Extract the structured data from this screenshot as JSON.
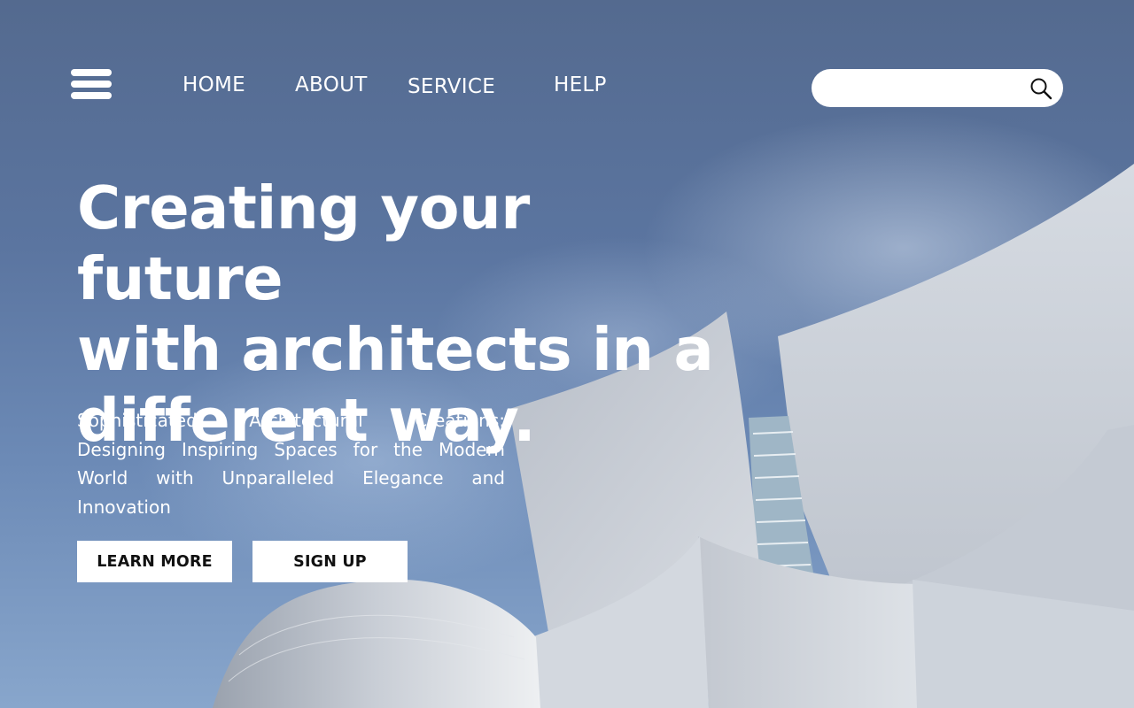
{
  "nav": {
    "menu_icon": "hamburger-menu-icon",
    "links": [
      {
        "label": "HOME"
      },
      {
        "label": "ABOUT"
      },
      {
        "label": "SERVICE"
      },
      {
        "label": "HELP"
      }
    ]
  },
  "search": {
    "value": "",
    "placeholder": "",
    "icon": "search-icon"
  },
  "hero": {
    "headline_lines": [
      "Creating your future",
      "with architects in a",
      "different way."
    ],
    "subtext": "Sophisticated Architectural Creations: Designing Inspiring Spaces for the Modern World with Unparalleled Elegance and Innovation",
    "buttons": {
      "learn_more": "LEARN MORE",
      "sign_up": "SIGN UP"
    }
  },
  "colors": {
    "sky": "#5a7098",
    "text": "#ffffff",
    "button_bg": "#ffffff",
    "button_text": "#111111",
    "steel": "#c9cfd8"
  }
}
